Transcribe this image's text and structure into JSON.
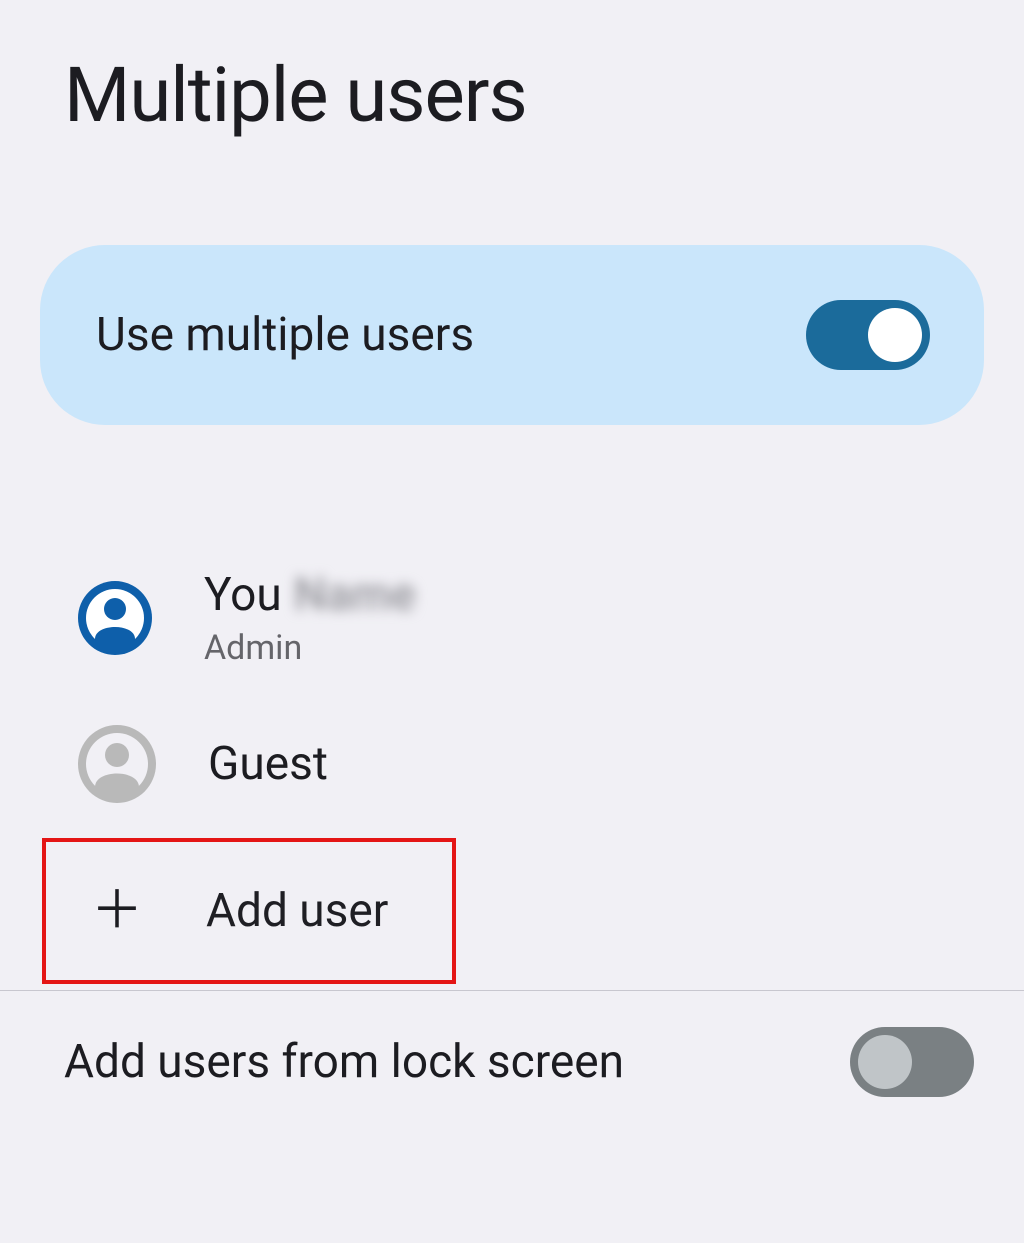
{
  "page": {
    "title": "Multiple users"
  },
  "toggle_card": {
    "label": "Use multiple users",
    "state": "on"
  },
  "users": {
    "you": {
      "name": "You",
      "redacted_name": "Name",
      "role": "Admin"
    },
    "guest": {
      "name": "Guest"
    }
  },
  "add_user": {
    "label": "Add user"
  },
  "lock_screen": {
    "label": "Add users from lock screen",
    "state": "off"
  },
  "colors": {
    "accent": "#1b6b9b",
    "avatar_primary": "#0e5faa",
    "avatar_grey": "#b9b9b9",
    "highlight_border": "#e41515"
  }
}
